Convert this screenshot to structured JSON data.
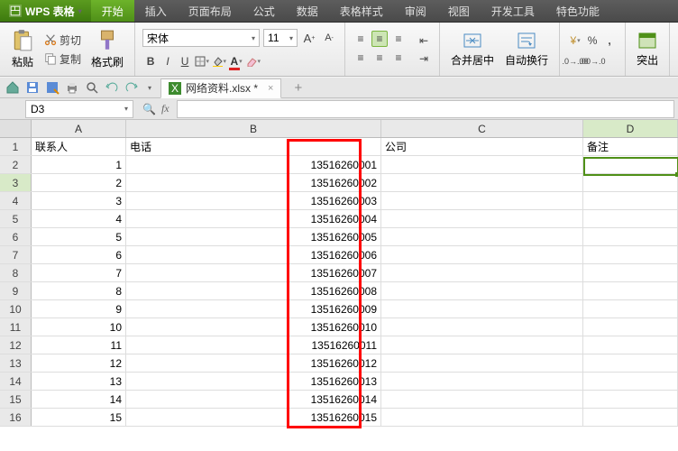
{
  "app": {
    "name": "WPS 表格"
  },
  "tabs": [
    "开始",
    "插入",
    "页面布局",
    "公式",
    "数据",
    "表格样式",
    "审阅",
    "视图",
    "开发工具",
    "特色功能"
  ],
  "active_tab": 0,
  "clipboard": {
    "paste": "粘贴",
    "cut": "剪切",
    "copy": "复制",
    "format_painter": "格式刷"
  },
  "font": {
    "name": "宋体",
    "size": "11"
  },
  "align": {
    "merge_center": "合并居中",
    "wrap": "自动换行"
  },
  "number": {
    "export": "突出"
  },
  "doc": {
    "filename": "网络资料.xlsx *"
  },
  "namebox": "D3",
  "fx_label": "fx",
  "col_headers": [
    "A",
    "B",
    "C",
    "D"
  ],
  "headers": {
    "A": "联系人",
    "B": "电话",
    "C": "公司",
    "D": "备注"
  },
  "rows": [
    {
      "n": "1",
      "A": "联系人",
      "B": "电话",
      "C": "公司",
      "D": "备注",
      "hdr": true
    },
    {
      "n": "2",
      "A": "1",
      "B": "13516260001"
    },
    {
      "n": "3",
      "A": "2",
      "B": "13516260002",
      "sel": true
    },
    {
      "n": "4",
      "A": "3",
      "B": "13516260003"
    },
    {
      "n": "5",
      "A": "4",
      "B": "13516260004"
    },
    {
      "n": "6",
      "A": "5",
      "B": "13516260005"
    },
    {
      "n": "7",
      "A": "6",
      "B": "13516260006"
    },
    {
      "n": "8",
      "A": "7",
      "B": "13516260007"
    },
    {
      "n": "9",
      "A": "8",
      "B": "13516260008"
    },
    {
      "n": "10",
      "A": "9",
      "B": "13516260009"
    },
    {
      "n": "11",
      "A": "10",
      "B": "13516260010"
    },
    {
      "n": "12",
      "A": "11",
      "B": "13516260011"
    },
    {
      "n": "13",
      "A": "12",
      "B": "13516260012"
    },
    {
      "n": "14",
      "A": "13",
      "B": "13516260013"
    },
    {
      "n": "15",
      "A": "14",
      "B": "13516260014"
    },
    {
      "n": "16",
      "A": "15",
      "B": "13516260015"
    }
  ]
}
